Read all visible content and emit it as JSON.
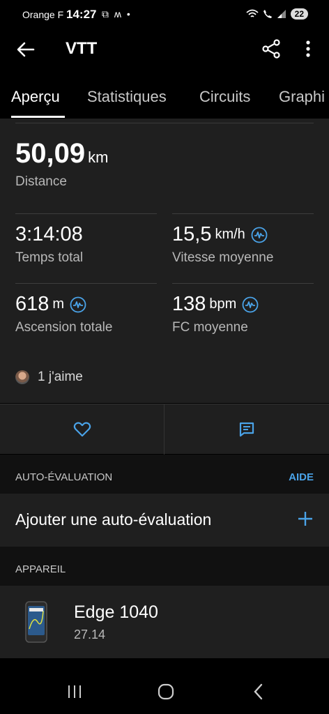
{
  "status_bar": {
    "carrier": "Orange F",
    "time": "14:27",
    "left_icons": [
      "screen-record-icon",
      "messenger-icon",
      "dot-icon"
    ],
    "right_icons": [
      "wifi-icon",
      "call-icon",
      "signal-icon"
    ],
    "battery": "22"
  },
  "app_bar": {
    "title": "VTT",
    "back_icon": "arrow-left-icon",
    "share_icon": "share-icon",
    "more_icon": "more-vertical-icon"
  },
  "tabs": [
    {
      "label": "Aperçu",
      "active": true
    },
    {
      "label": "Statistiques",
      "active": false
    },
    {
      "label": "Circuits",
      "active": false
    },
    {
      "label": "Graphi",
      "active": false
    }
  ],
  "summary": {
    "distance": {
      "value": "50,09",
      "unit": "km",
      "label": "Distance"
    },
    "total_time": {
      "value": "3:14:08",
      "unit": "",
      "label": "Temps total"
    },
    "avg_speed": {
      "value": "15,5",
      "unit": "km/h",
      "label": "Vitesse moyenne"
    },
    "ascent": {
      "value": "618",
      "unit": "m",
      "label": "Ascension totale"
    },
    "avg_hr": {
      "value": "138",
      "unit": "bpm",
      "label": "FC moyenne"
    },
    "likes": "1 j'aime"
  },
  "actions": {
    "like_icon": "heart-icon",
    "comment_icon": "comment-icon"
  },
  "self_eval": {
    "header": "AUTO-ÉVALUATION",
    "help": "AIDE",
    "add_label": "Ajouter une auto-évaluation"
  },
  "device_section": {
    "header": "APPAREIL",
    "name": "Edge 1040",
    "version": "27.14"
  },
  "colors": {
    "accent": "#4aa3e8",
    "card": "#1f1f1f",
    "background": "#000000"
  }
}
